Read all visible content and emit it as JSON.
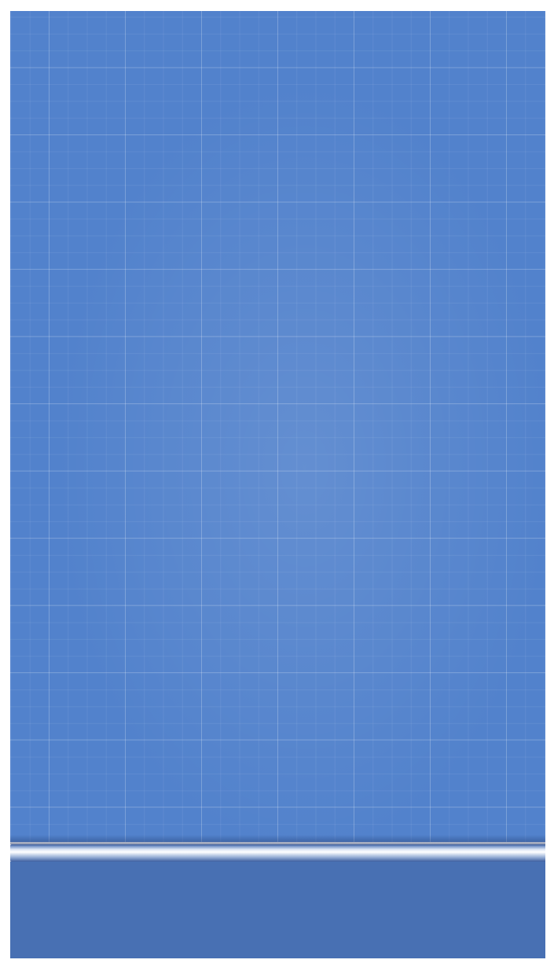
{
  "screen": {
    "background": "blueprint-grid",
    "colors": {
      "grid_background": "#5282cc",
      "shelf_highlight": "#ffffff",
      "bottom_panel": "#4870b3"
    }
  }
}
